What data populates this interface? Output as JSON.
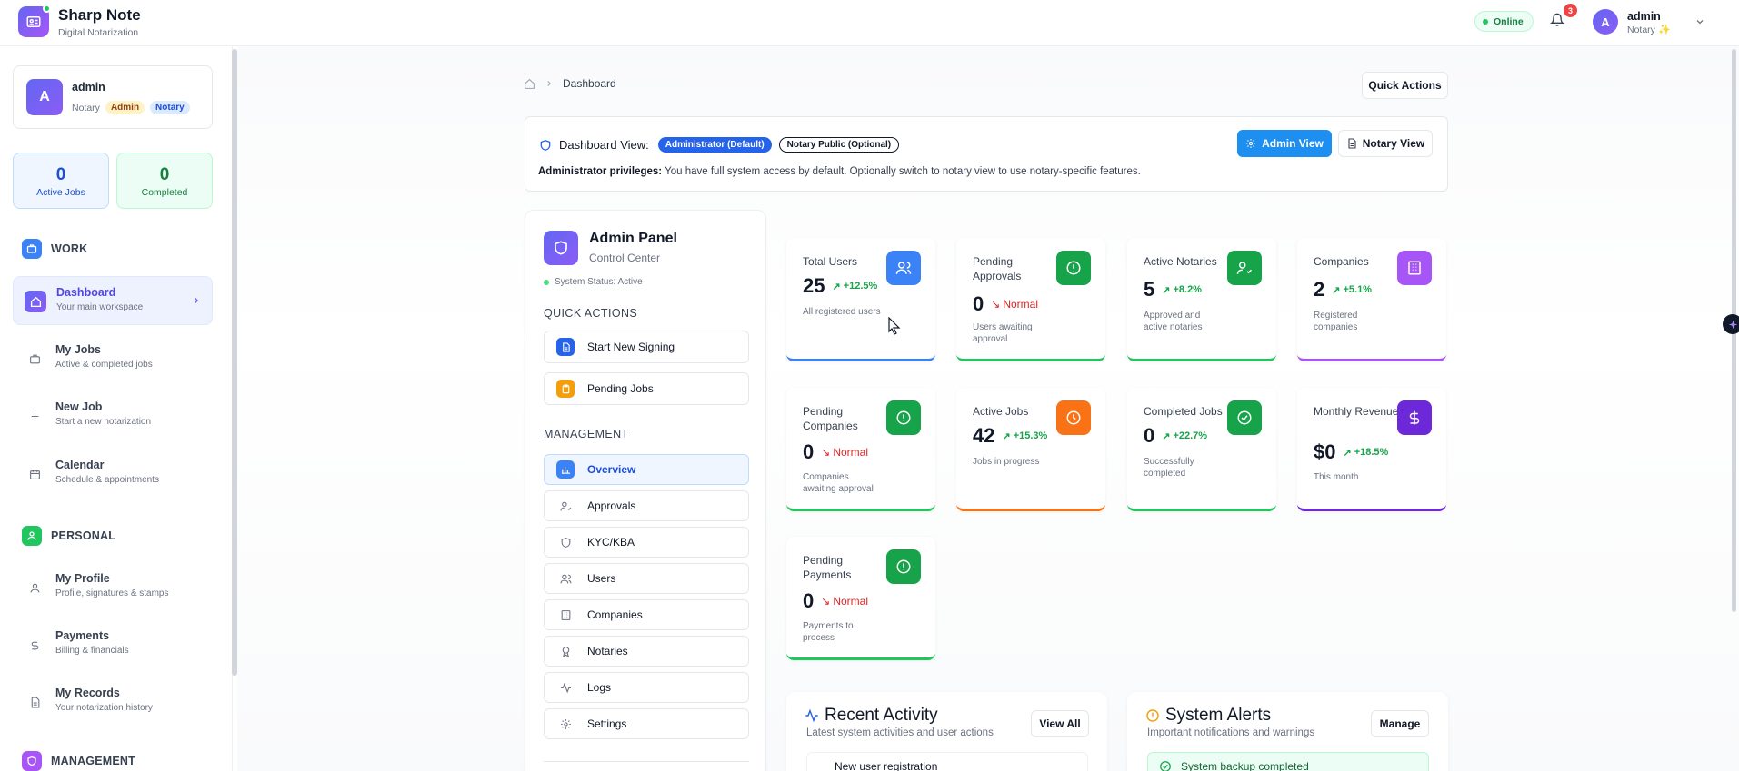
{
  "header": {
    "brand_title": "Sharp Note",
    "brand_subtitle": "Digital Notarization",
    "status": "Online",
    "notification_count": "3",
    "user_initial": "A",
    "user_name": "admin",
    "user_role": "Notary"
  },
  "sidebar": {
    "user_card": {
      "initial": "A",
      "name": "admin",
      "role": "Notary",
      "badge_admin": "Admin",
      "badge_notary": "Notary"
    },
    "stats": {
      "active_jobs_value": "0",
      "active_jobs_label": "Active Jobs",
      "completed_value": "0",
      "completed_label": "Completed"
    },
    "sections": {
      "work": "WORK",
      "personal": "PERSONAL",
      "management": "MANAGEMENT"
    },
    "work_items": [
      {
        "title": "Dashboard",
        "subtitle": "Your main workspace"
      },
      {
        "title": "My Jobs",
        "subtitle": "Active & completed jobs"
      },
      {
        "title": "New Job",
        "subtitle": "Start a new notarization"
      },
      {
        "title": "Calendar",
        "subtitle": "Schedule & appointments"
      }
    ],
    "personal_items": [
      {
        "title": "My Profile",
        "subtitle": "Profile, signatures & stamps"
      },
      {
        "title": "Payments",
        "subtitle": "Billing & financials"
      },
      {
        "title": "My Records",
        "subtitle": "Your notarization history"
      }
    ]
  },
  "main": {
    "breadcrumb_current": "Dashboard",
    "quick_actions_button": "Quick Actions",
    "dashboard_view": {
      "label": "Dashboard View:",
      "pill_admin": "Administrator (Default)",
      "pill_notary": "Notary Public (Optional)",
      "admin_view_button": "Admin View",
      "notary_view_button": "Notary View",
      "privileges_label": "Administrator privileges:",
      "privileges_text": " You have full system access by default. Optionally switch to notary view to use notary-specific features."
    },
    "admin_panel": {
      "title": "Admin Panel",
      "subtitle": "Control Center",
      "status": "System Status: Active",
      "quick_actions_heading": "QUICK ACTIONS",
      "quick_actions": [
        "Start New Signing",
        "Pending Jobs"
      ],
      "management_heading": "MANAGEMENT",
      "management_items": [
        "Overview",
        "Approvals",
        "KYC/KBA",
        "Users",
        "Companies",
        "Notaries",
        "Logs",
        "Settings"
      ]
    },
    "stat_cards": [
      {
        "title": "Total Users",
        "value": "25",
        "trend": "+12.5%",
        "desc": "All registered users",
        "color": "#3b82f6"
      },
      {
        "title": "Pending Approvals",
        "value": "0",
        "trend": "Normal",
        "desc": "Users awaiting approval",
        "color": "#22c55e"
      },
      {
        "title": "Active Notaries",
        "value": "5",
        "trend": "+8.2%",
        "desc": "Approved and active notaries",
        "color": "#22c55e"
      },
      {
        "title": "Companies",
        "value": "2",
        "trend": "+5.1%",
        "desc": "Registered companies",
        "color": "#a855f7"
      },
      {
        "title": "Pending Companies",
        "value": "0",
        "trend": "Normal",
        "desc": "Companies awaiting approval",
        "color": "#22c55e"
      },
      {
        "title": "Active Jobs",
        "value": "42",
        "trend": "+15.3%",
        "desc": "Jobs in progress",
        "color": "#f97316"
      },
      {
        "title": "Completed Jobs",
        "value": "0",
        "trend": "+22.7%",
        "desc": "Successfully completed",
        "color": "#22c55e"
      },
      {
        "title": "Monthly Revenue",
        "value": "$0",
        "trend": "+18.5%",
        "desc": "This month",
        "color": "#6d28d9"
      },
      {
        "title": "Pending Payments",
        "value": "0",
        "trend": "Normal",
        "desc": "Payments to process",
        "color": "#22c55e"
      }
    ],
    "recent_activity": {
      "title": "Recent Activity",
      "subtitle": "Latest system activities and user actions",
      "button": "View All",
      "first_item": "New user registration"
    },
    "system_alerts": {
      "title": "System Alerts",
      "subtitle": "Important notifications and warnings",
      "button": "Manage",
      "first_item": "System backup completed"
    }
  }
}
